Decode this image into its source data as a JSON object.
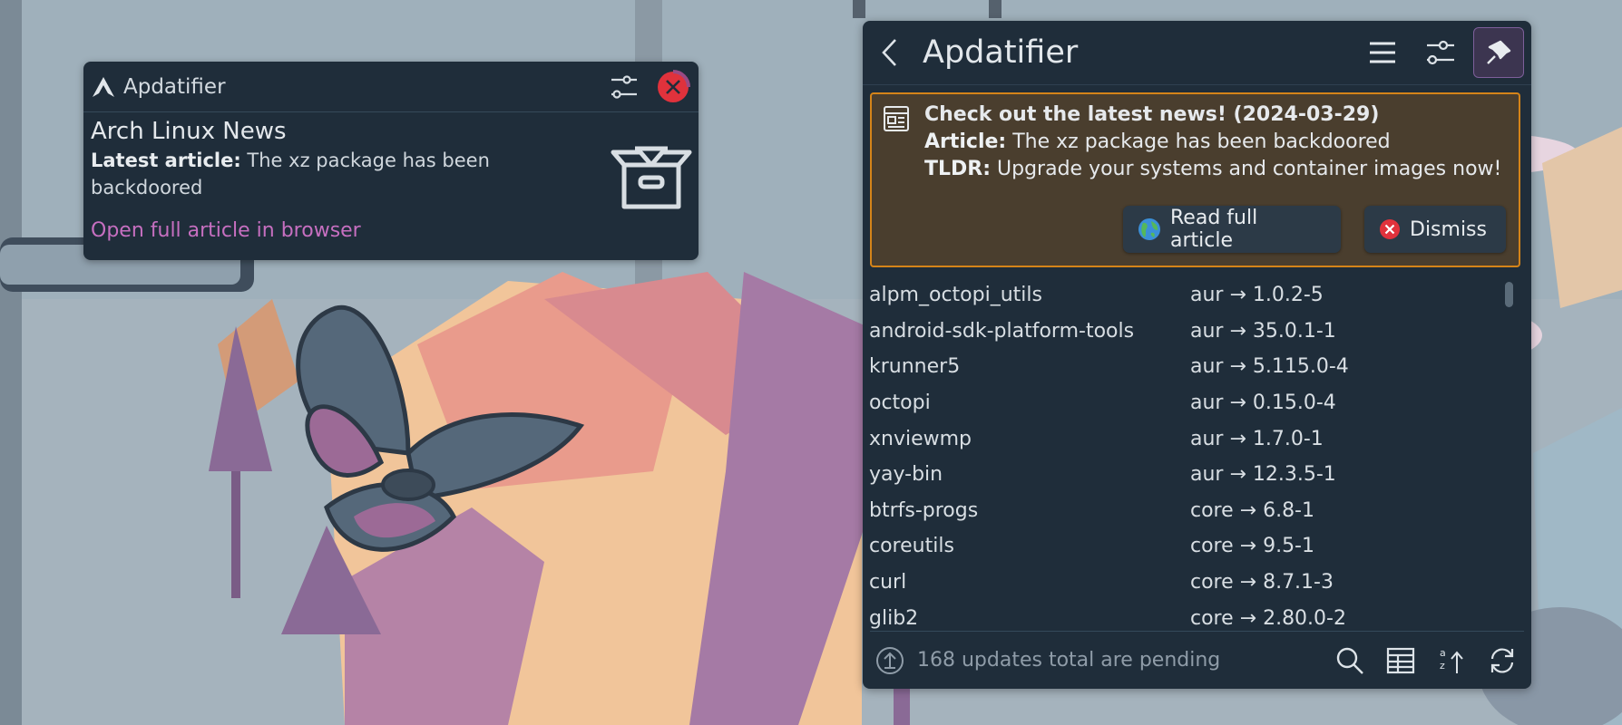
{
  "notification": {
    "app_name": "Apdatifier",
    "title": "Arch Linux News",
    "latest_label": "Latest article:",
    "latest_text": " The xz package has been backdoored",
    "link": "Open full article in browser",
    "icons": [
      "arch-logo-icon",
      "sliders-icon",
      "close-icon",
      "package-box-icon"
    ]
  },
  "widget": {
    "title": "Apdatifier",
    "header_icons": [
      "back-icon",
      "menu-icon",
      "sliders-icon",
      "pin-icon"
    ],
    "news": {
      "heading": "Check out the latest news! (2024-03-29)",
      "article_label": "Article:",
      "article_text": " The xz package has been backdoored",
      "tldr_label": "TLDR:",
      "tldr_text": " Upgrade your systems and container images now!",
      "read_button": "Read full article",
      "dismiss_button": "Dismiss"
    },
    "packages": [
      {
        "name": "alpm_octopi_utils",
        "version": "aur → 1.0.2-5"
      },
      {
        "name": "android-sdk-platform-tools",
        "version": "aur → 35.0.1-1"
      },
      {
        "name": "krunner5",
        "version": "aur → 5.115.0-4"
      },
      {
        "name": "octopi",
        "version": "aur → 0.15.0-4"
      },
      {
        "name": "xnviewmp",
        "version": "aur → 1.7.0-1"
      },
      {
        "name": "yay-bin",
        "version": "aur → 12.3.5-1"
      },
      {
        "name": "btrfs-progs",
        "version": "core → 6.8-1"
      },
      {
        "name": "coreutils",
        "version": "core → 9.5-1"
      },
      {
        "name": "curl",
        "version": "core → 8.7.1-3"
      },
      {
        "name": "glib2",
        "version": "core → 2.80.0-2"
      }
    ],
    "status": "168 updates total are pending",
    "footer_icons": [
      "search-icon",
      "view-icon",
      "sort-icon",
      "refresh-icon"
    ]
  },
  "colors": {
    "panel_bg": "#1f2d3a",
    "news_bg": "#4a3e2e",
    "news_border": "#d58419",
    "link": "#c66fc0",
    "close_red": "#e0323c"
  }
}
